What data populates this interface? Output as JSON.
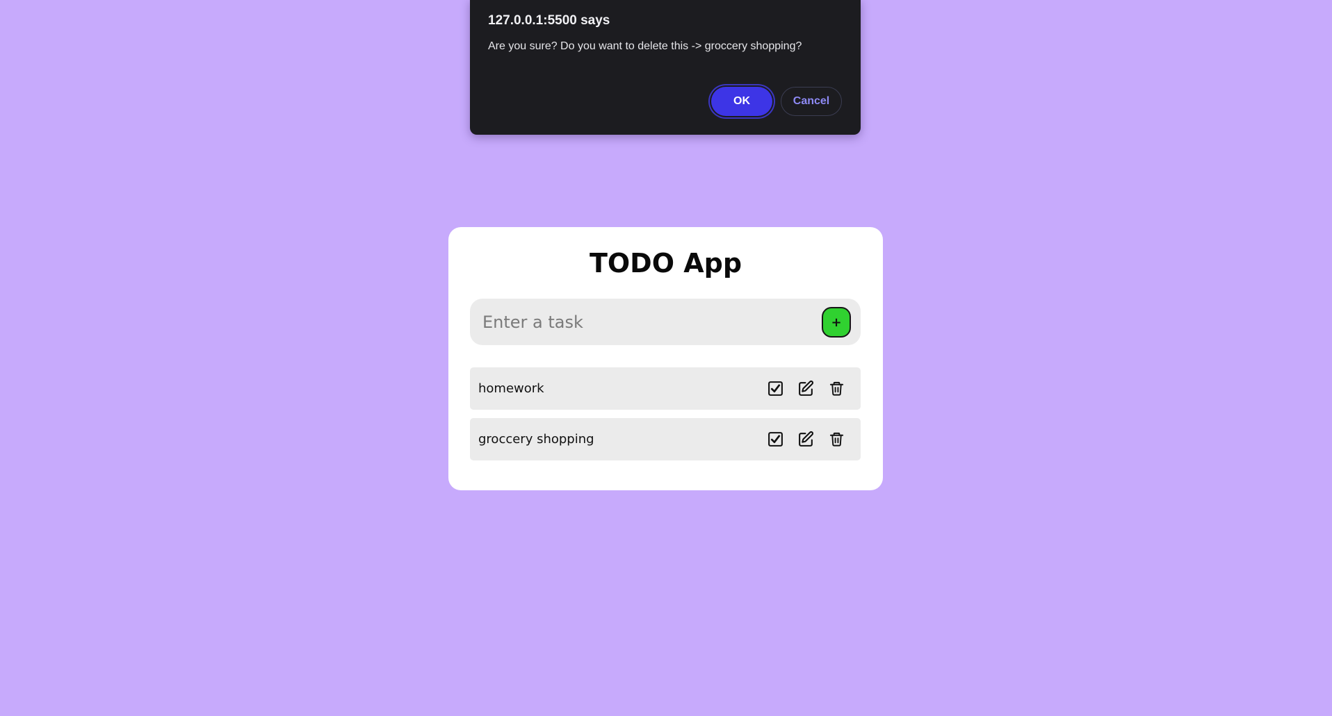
{
  "dialog": {
    "title": "127.0.0.1:5500 says",
    "message": "Are you sure? Do you want to delete this -> groccery shopping?",
    "ok_label": "OK",
    "cancel_label": "Cancel"
  },
  "app": {
    "title": "TODO App",
    "input": {
      "placeholder": "Enter a task",
      "value": ""
    },
    "add_button_label": "+",
    "tasks": [
      {
        "text": "homework",
        "icons": [
          "check-square-icon",
          "edit-icon",
          "trash-icon"
        ]
      },
      {
        "text": "groccery shopping",
        "icons": [
          "check-square-icon",
          "edit-icon",
          "trash-icon"
        ]
      }
    ]
  },
  "colors": {
    "background": "#c7aafc",
    "dialog_bg": "#1c1c20",
    "ok_button": "#3d35e6",
    "cancel_text": "#8e8af5",
    "add_button": "#30d130",
    "card": "#ffffff",
    "row_bg": "#ebebeb"
  }
}
